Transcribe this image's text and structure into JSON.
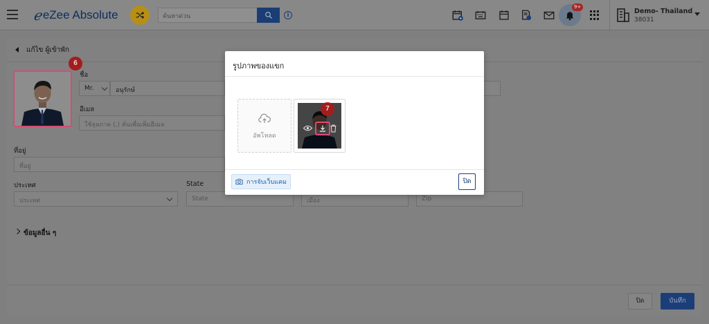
{
  "topbar": {
    "app_name": "eZee Absolute",
    "search_placeholder": "ค้นหาด่วน",
    "notification_count": "9+",
    "hotel_name": "Demo- Thailand",
    "hotel_id": "38031",
    "icons": [
      "hamburger-icon",
      "shuffle-icon",
      "search-icon",
      "info-icon",
      "calendar-add-icon",
      "keyboard-icon",
      "calendar-icon",
      "invoice-icon",
      "mail-icon",
      "bell-icon",
      "apps-grid-icon",
      "hotel-building-icon",
      "caret-down-icon"
    ]
  },
  "page": {
    "title": "แก้ไข ผู้เข้าพัก",
    "avatar_step": "6",
    "name_label": "ชื่อ",
    "salutation": "Mr.",
    "first_name": "อนุรักษ์",
    "email_label": "อีเมล",
    "email_placeholder": "ใช้จุลภาค (,) คั่นเพื่อเพิ่มอีเมล",
    "address_label": "ที่อยู่",
    "address_placeholder": "ที่อยู่",
    "country_label": "ประเทศ",
    "country_placeholder": "ประเทศ",
    "state_label": "State",
    "state_placeholder": "State",
    "city_placeholder": "เมือง",
    "zip_placeholder": "Zip",
    "more_info_label": "ข้อมูลอื่น ๆ",
    "close_label": "ปิด",
    "save_label": "บันทึก"
  },
  "modal": {
    "title": "รูปภาพของแขก",
    "upload_label": "อัพโหลด",
    "photo_step": "7",
    "webcam_label": "การจับเว็บแคม",
    "close_label": "ปิด"
  },
  "colors": {
    "brand_blue": "#1b3e78",
    "highlight_pink": "#e14a78",
    "step_red": "#c0392b",
    "overlay": "#7f7f7f"
  }
}
